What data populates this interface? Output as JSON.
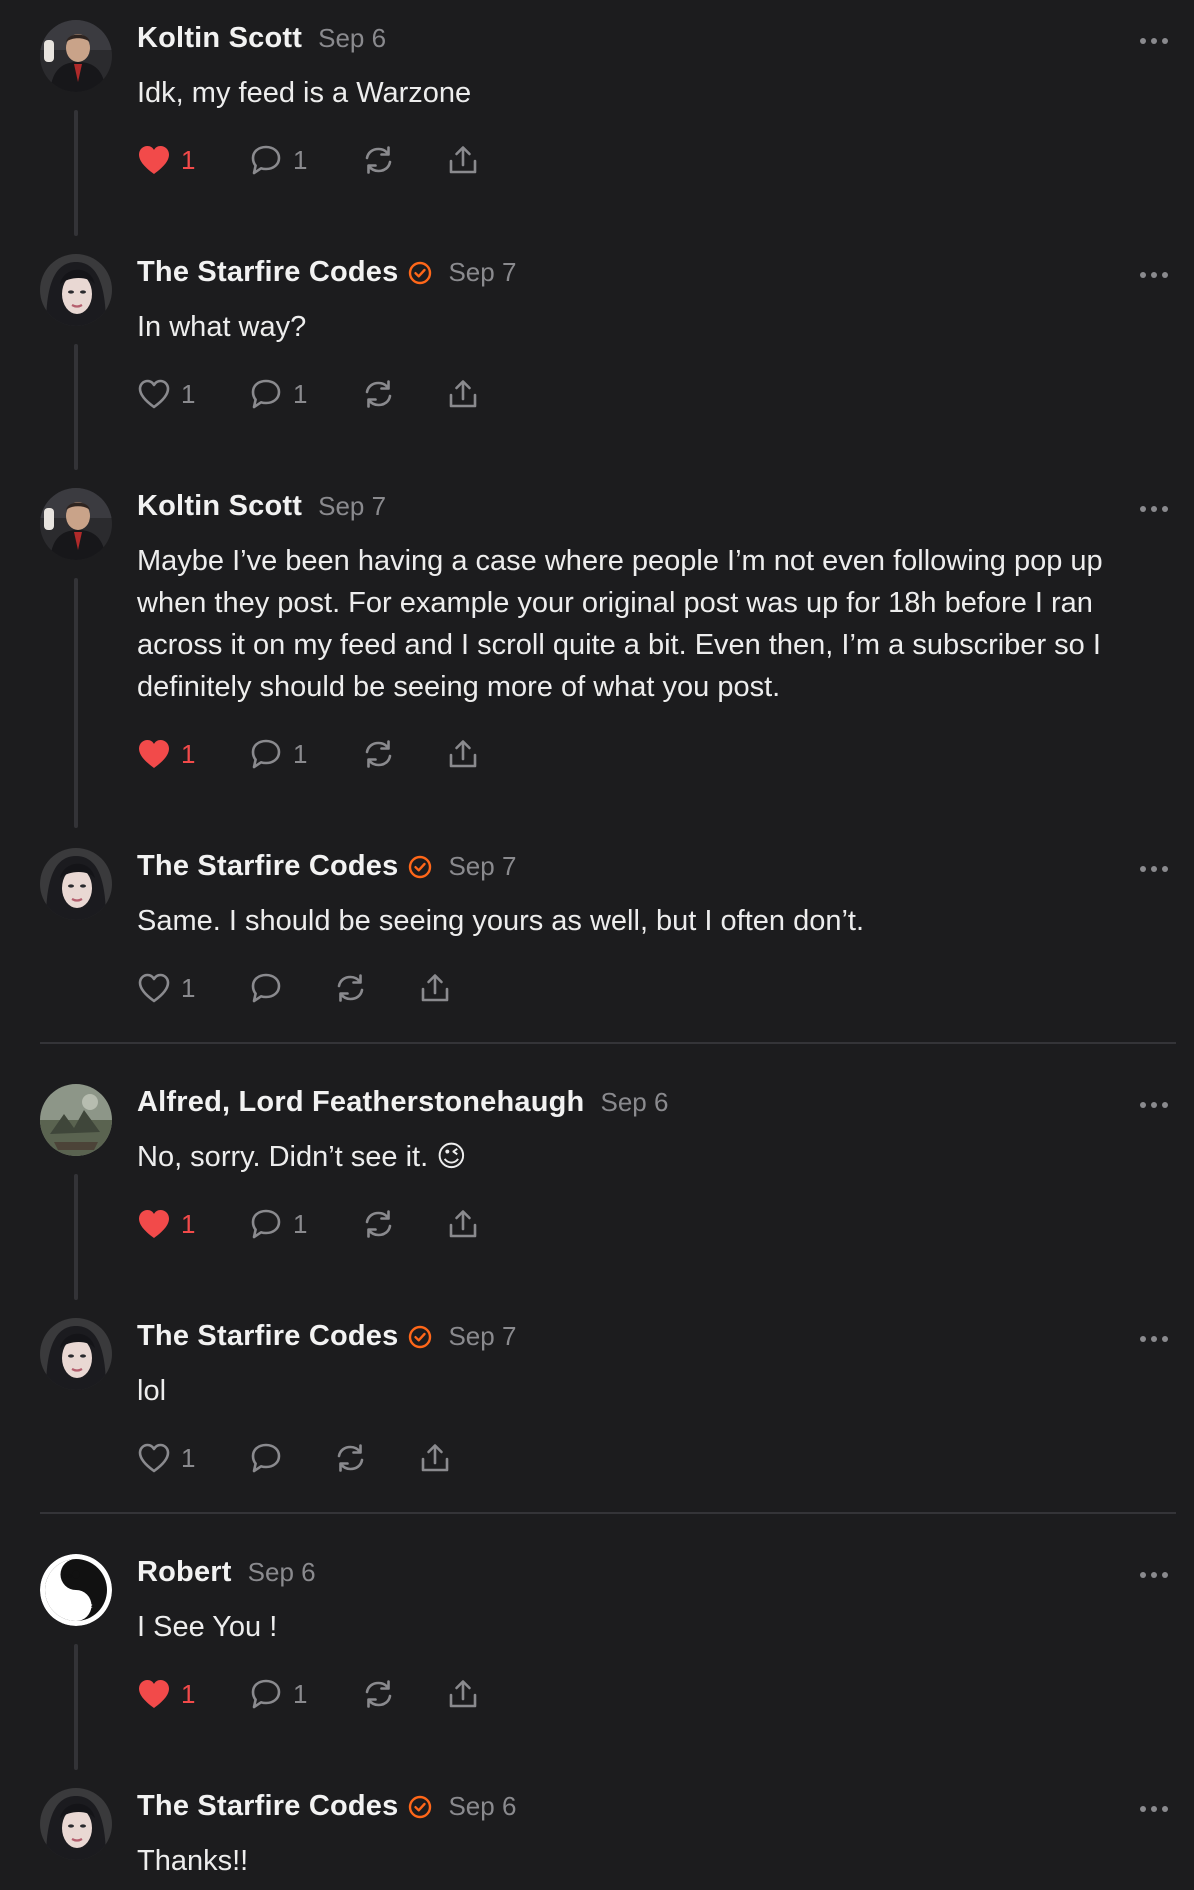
{
  "theme": {
    "background": "#1c1c1e",
    "like_color": "#f24a4a",
    "badge_color": "#ff6719",
    "muted_text": "#8a8a8e"
  },
  "comments": [
    {
      "name": "Koltin Scott",
      "verified": false,
      "date": "Sep 6",
      "text": "Idk, my feed is a Warzone",
      "likes": "1",
      "liked": true,
      "replies": "1",
      "avatar": "koltin-avatar"
    },
    {
      "name": "The Starfire Codes",
      "verified": true,
      "date": "Sep 7",
      "text": "In what way?",
      "likes": "1",
      "liked": false,
      "replies": "1",
      "avatar": "starfire-avatar"
    },
    {
      "name": "Koltin Scott",
      "verified": false,
      "date": "Sep 7",
      "text": "Maybe I’ve been having a case where people I’m not even following pop up when they post. For example your original post was up for 18h before I ran across it on my feed and I scroll quite a bit. Even then, I’m a subscriber so I definitely should be seeing more of what you post.",
      "likes": "1",
      "liked": true,
      "replies": "1",
      "avatar": "koltin-avatar"
    },
    {
      "name": "The Starfire Codes",
      "verified": true,
      "date": "Sep 7",
      "text": "Same. I should be seeing yours as well, but I often don’t.",
      "likes": "1",
      "liked": false,
      "replies": "",
      "avatar": "starfire-avatar"
    },
    {
      "name": "Alfred, Lord Featherstonehaugh",
      "verified": false,
      "date": "Sep 6",
      "text": "No, sorry. Didn’t see it. 😉",
      "likes": "1",
      "liked": true,
      "replies": "1",
      "avatar": "alfred-avatar"
    },
    {
      "name": "The Starfire Codes",
      "verified": true,
      "date": "Sep 7",
      "text": "lol",
      "likes": "1",
      "liked": false,
      "replies": "",
      "avatar": "starfire-avatar"
    },
    {
      "name": "Robert",
      "verified": false,
      "date": "Sep 6",
      "text": "I See You !",
      "likes": "1",
      "liked": true,
      "replies": "1",
      "avatar": "robert-avatar"
    },
    {
      "name": "The Starfire Codes",
      "verified": true,
      "date": "Sep 6",
      "text": "Thanks!!",
      "likes": "",
      "liked": false,
      "replies": "",
      "avatar": "starfire-avatar"
    }
  ],
  "icons": {
    "like": "heart-icon",
    "reply": "comment-bubble-icon",
    "restack": "restack-arrows-icon",
    "share": "share-icon",
    "more": "more-dots-icon",
    "verified": "verified-check-icon"
  }
}
